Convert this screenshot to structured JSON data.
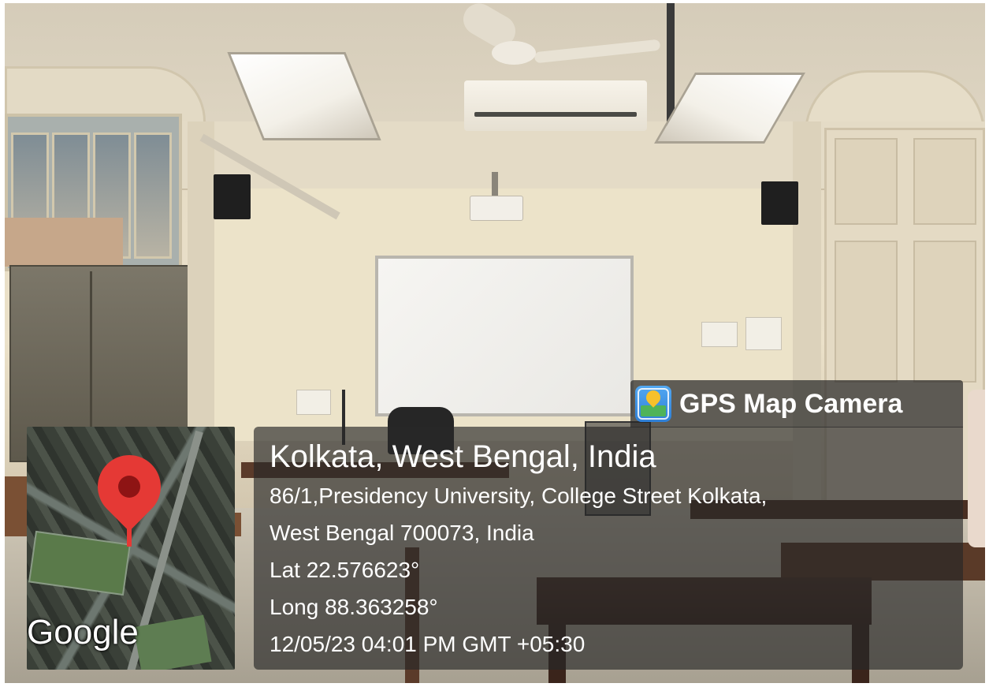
{
  "gps_banner": {
    "app_name": "GPS Map Camera",
    "icon": "gps-map-camera-app-icon"
  },
  "location": {
    "city_line": "Kolkata, West Bengal, India",
    "address_line1": "86/1,Presidency University, College Street Kolkata,",
    "address_line2": "West Bengal 700073, India",
    "latitude": "Lat 22.576623°",
    "longitude": "Long 88.363258°",
    "datetime": "12/05/23 04:01 PM GMT +05:30"
  },
  "map": {
    "logo_text": "Google",
    "pin_icon": "map-pin-icon",
    "pin_color": "#e53935"
  },
  "colors": {
    "overlay": "#282828",
    "text": "#ffffff"
  }
}
